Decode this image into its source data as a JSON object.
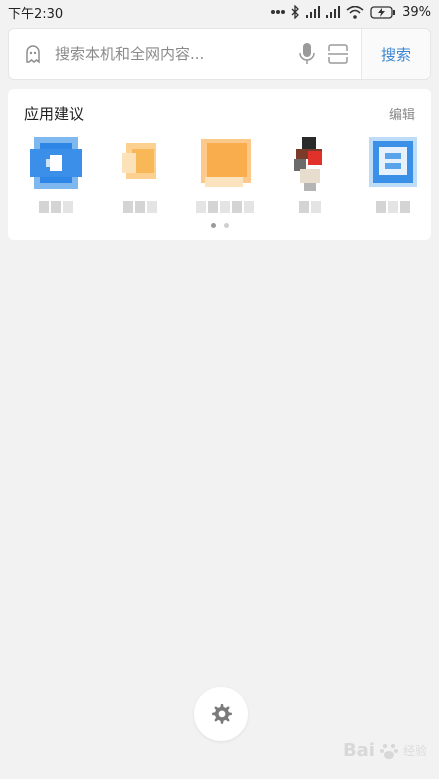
{
  "status": {
    "time": "下午2:30",
    "battery": "39%"
  },
  "search": {
    "placeholder": "搜索本机和全网内容...",
    "button": "搜索"
  },
  "suggestions": {
    "title": "应用建议",
    "edit": "编辑"
  },
  "watermark": {
    "text": "Bai",
    "sub": "经验"
  }
}
